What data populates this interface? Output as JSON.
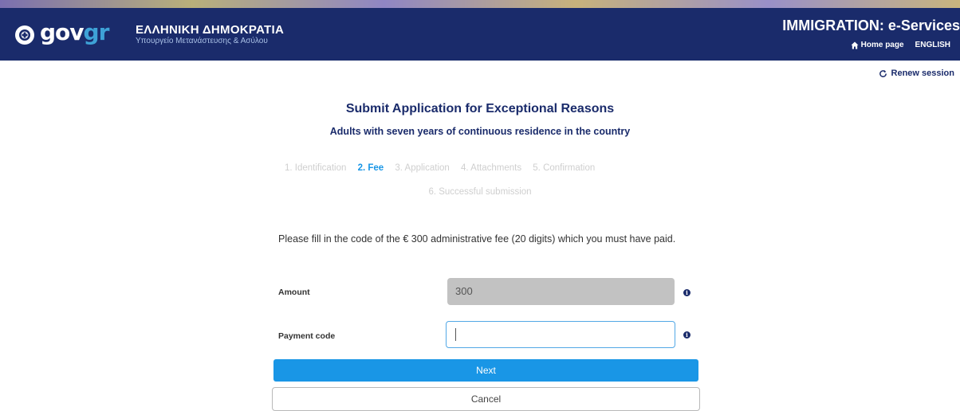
{
  "header": {
    "logo_part1": "gov",
    "logo_part2": "gr",
    "republic_title": "ΕΛΛΗΝΙΚΗ ΔΗΜΟΚΡΑΤΙΑ",
    "ministry_subtitle": "Υπουργείο Μετανάστευσης & Ασύλου",
    "service_title": "IMMIGRATION: e-Services",
    "home_link": "Home page",
    "language_link": "ENGLISH"
  },
  "session": {
    "renew_label": "Renew session"
  },
  "page": {
    "title": "Submit Application for Exceptional Reasons",
    "subtitle": "Adults with seven years of continuous residence in the country"
  },
  "steps": [
    {
      "label": "1. Identification",
      "active": false
    },
    {
      "label": "2. Fee",
      "active": true
    },
    {
      "label": "3. Application",
      "active": false
    },
    {
      "label": "4. Attachments",
      "active": false
    },
    {
      "label": "5. Confirmation",
      "active": false
    },
    {
      "label": "6. Successful submission",
      "active": false
    }
  ],
  "form": {
    "instructions": "Please fill in the code of the € 300 administrative fee (20 digits) which you must have paid.",
    "amount_label": "Amount",
    "amount_value": "300",
    "payment_label": "Payment code",
    "payment_value": "",
    "next_label": "Next",
    "cancel_label": "Cancel"
  },
  "colors": {
    "header_bg": "#1a2b6b",
    "accent": "#1996e6",
    "logo_gr": "#3ea2d7"
  },
  "icons": {
    "logo": "greek-emblem-icon",
    "home": "home-icon",
    "renew": "refresh-icon",
    "info": "info-icon"
  }
}
